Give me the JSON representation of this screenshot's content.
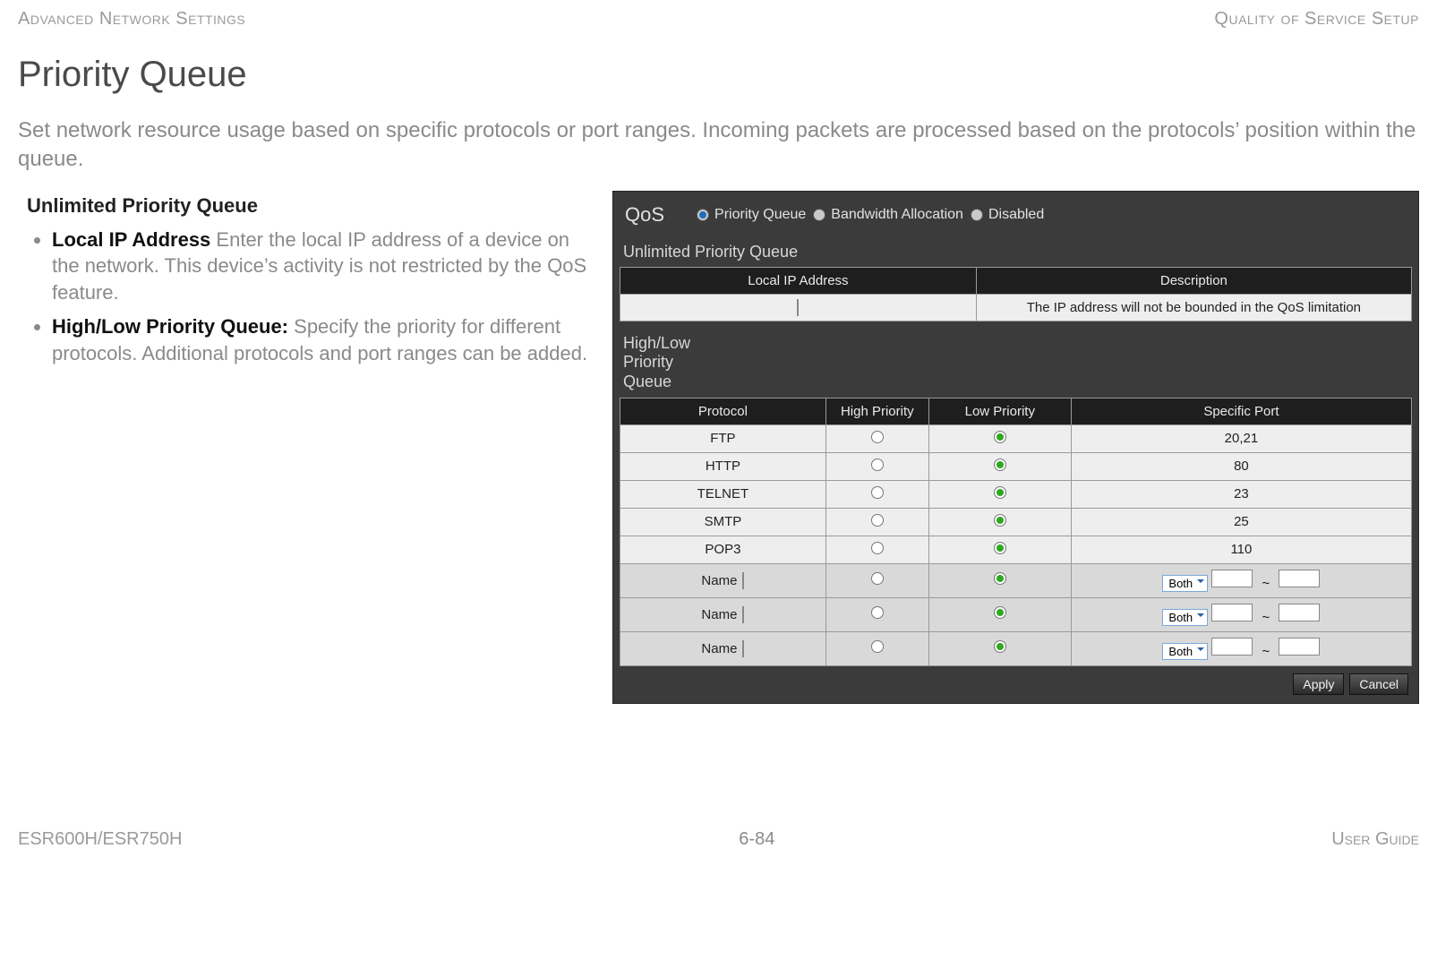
{
  "running_head": {
    "left": "Advanced Network Settings",
    "right": "Quality of Service Setup"
  },
  "page": {
    "title": "Priority Queue",
    "intro": "Set network resource usage based on specific protocols or port ranges. Incoming packets are processed based on the proto­cols’ position within the queue."
  },
  "left_col": {
    "heading": "Unlimited Priority Queue",
    "bullets": [
      {
        "term": "Local IP Address",
        "sep": "  ",
        "desc": "Enter the local IP address of a device on the network. This device’s activity is not restricted by the QoS feature."
      },
      {
        "term": "High/Low Priority Queue:",
        "sep": " ",
        "desc": "Specify the priority for differ­ent protocols. Additional protocols and port ranges can be added."
      }
    ]
  },
  "panel": {
    "qos_label": "QoS",
    "modes": [
      {
        "label": "Priority Queue",
        "selected": true
      },
      {
        "label": "Bandwidth Allocation",
        "selected": false
      },
      {
        "label": "Disabled",
        "selected": false
      }
    ],
    "unlimited": {
      "title": "Unlimited Priority Queue",
      "headers": [
        "Local IP Address",
        "Description"
      ],
      "desc_text": "The IP address will not be bounded in the QoS limitation"
    },
    "queue": {
      "title": "High/Low Priority Queue",
      "headers": [
        "Protocol",
        "High Priority",
        "Low Priority",
        "Specific Port"
      ],
      "rows": [
        {
          "protocol": "FTP",
          "high": false,
          "low": true,
          "port": "20,21"
        },
        {
          "protocol": "HTTP",
          "high": false,
          "low": true,
          "port": "80"
        },
        {
          "protocol": "TELNET",
          "high": false,
          "low": true,
          "port": "23"
        },
        {
          "protocol": "SMTP",
          "high": false,
          "low": true,
          "port": "25"
        },
        {
          "protocol": "POP3",
          "high": false,
          "low": true,
          "port": "110"
        }
      ],
      "custom_rows": 3,
      "name_label": "Name",
      "both_label": "Both",
      "tilde": "~"
    },
    "buttons": {
      "apply": "Apply",
      "cancel": "Cancel"
    }
  },
  "footer": {
    "left": "ESR600H/ESR750H",
    "mid": "6-84",
    "right": "User Guide"
  }
}
